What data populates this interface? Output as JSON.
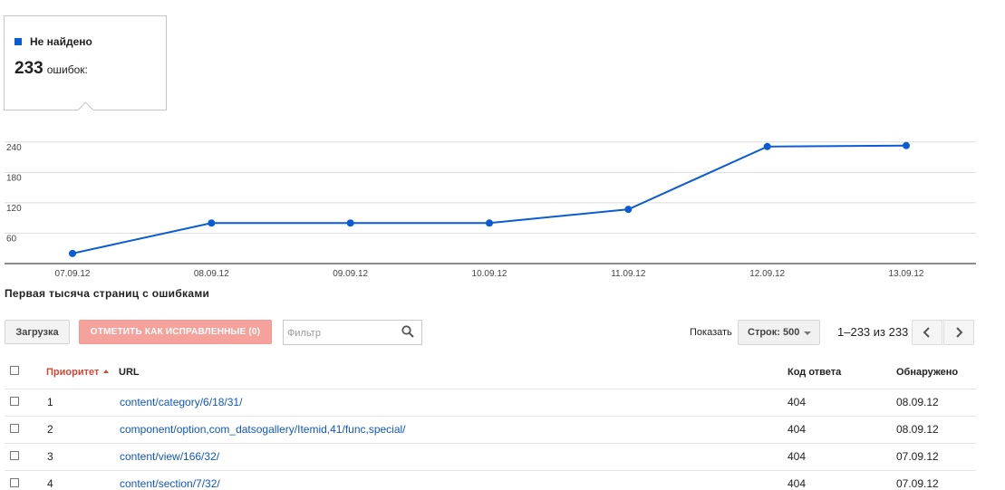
{
  "tooltip": {
    "series_name": "Не найдено",
    "count": "233",
    "count_unit": "ошибок:",
    "series_color": "#0b5bd3"
  },
  "chart_data": {
    "type": "line",
    "categories": [
      "07.09.12",
      "08.09.12",
      "09.09.12",
      "10.09.12",
      "11.09.12",
      "12.09.12",
      "13.09.12"
    ],
    "series": [
      {
        "values": [
          20,
          80,
          80,
          80,
          107,
          231,
          233
        ]
      }
    ],
    "yticks": [
      60,
      120,
      180,
      240
    ],
    "ylim": [
      0,
      270
    ],
    "grid": true,
    "line_color": "#0b5bd3"
  },
  "section_title": "Первая тысяча страниц с ошибками",
  "toolbar": {
    "load_label": "Загрузка",
    "mark_fixed_label": "ОТМЕТИТЬ КАК ИСПРАВЛЕННЫЕ (0)",
    "filter_placeholder": "Фильтр",
    "show_label": "Показать",
    "rows_select_value": "Строк: 500",
    "range_text": "1–233 из 233"
  },
  "table": {
    "headers": {
      "priority": "Приоритет",
      "url": "URL",
      "response_code": "Код ответа",
      "detected": "Обнаружено"
    },
    "rows": [
      {
        "priority": "1",
        "url": "content/category/6/18/31/",
        "code": "404",
        "detected": "08.09.12"
      },
      {
        "priority": "2",
        "url": "component/option,com_datsogallery/Itemid,41/func,special/",
        "code": "404",
        "detected": "08.09.12"
      },
      {
        "priority": "3",
        "url": "content/view/166/32/",
        "code": "404",
        "detected": "07.09.12"
      },
      {
        "priority": "4",
        "url": "content/section/7/32/",
        "code": "404",
        "detected": "07.09.12"
      }
    ]
  }
}
